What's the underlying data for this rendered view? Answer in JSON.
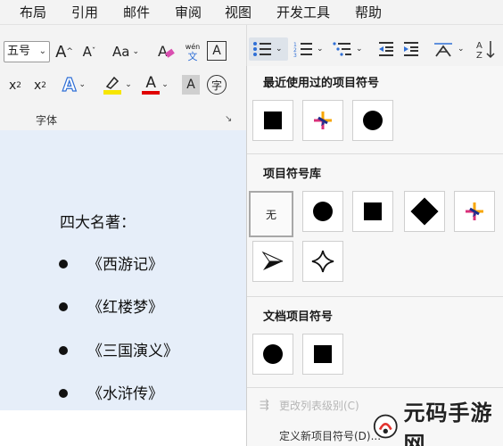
{
  "menu": [
    "布局",
    "引用",
    "邮件",
    "审阅",
    "视图",
    "开发工具",
    "帮助"
  ],
  "ribbon": {
    "font_size": "五号",
    "grow_font": "A",
    "shrink_font": "A",
    "change_case": "Aa",
    "pinyin_top": "wén",
    "pinyin_bottom": "文",
    "char_border": "A",
    "subscript": "x",
    "subscript_mark": "2",
    "superscript": "x",
    "superscript_mark": "2",
    "text_effect": "A",
    "font_color": "A",
    "char_shading": "A",
    "enclose_char": "字",
    "group_label": "字体",
    "highlight_color": "#f7e600",
    "font_color_value": "#e00000",
    "text_effect_color": "#2f6fd6"
  },
  "document": {
    "heading": "四大名著：",
    "items": [
      "《西游记》",
      "《红楼梦》",
      "《三国演义》",
      "《水浒传》"
    ]
  },
  "panel": {
    "recent_title": "最近使用过的项目符号",
    "library_title": "项目符号库",
    "doc_title": "文档项目符号",
    "none_label": "无",
    "change_level": "更改列表级别(C)",
    "define_new": "定义新项目符号(D)..."
  },
  "watermark": "元码手游网"
}
